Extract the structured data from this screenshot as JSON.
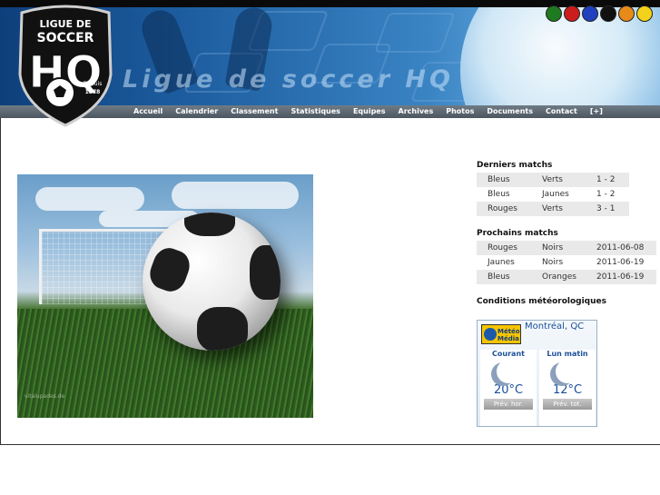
{
  "site": {
    "title": "Ligue de soccer HQ",
    "logo": {
      "line1": "LIGUE DE",
      "line2": "SOCCER",
      "initials": "HQ",
      "since": "Depuis",
      "year": "1978"
    }
  },
  "color_swatches": [
    "#1f7a1f",
    "#cc1d1d",
    "#2040c0",
    "#111111",
    "#e88a1a",
    "#f2d21a"
  ],
  "nav": [
    "Accueil",
    "Calendrier",
    "Classement",
    "Statistiques",
    "Equipes",
    "Archives",
    "Photos",
    "Documents",
    "Contact",
    "[+]"
  ],
  "hero": {
    "watermark": "vitalupades.de"
  },
  "last_matches": {
    "title": "Derniers matchs",
    "rows": [
      {
        "home": "Bleus",
        "away": "Verts",
        "score": "1 - 2"
      },
      {
        "home": "Bleus",
        "away": "Jaunes",
        "score": "1 - 2"
      },
      {
        "home": "Rouges",
        "away": "Verts",
        "score": "3 - 1"
      }
    ]
  },
  "next_matches": {
    "title": "Prochains matchs",
    "rows": [
      {
        "home": "Rouges",
        "away": "Noirs",
        "date": "2011-06-08"
      },
      {
        "home": "Jaunes",
        "away": "Noirs",
        "date": "2011-06-19"
      },
      {
        "home": "Bleus",
        "away": "Oranges",
        "date": "2011-06-19"
      }
    ]
  },
  "weather": {
    "title": "Conditions météorologiques",
    "brand_line1": "Météo",
    "brand_line2": "Média",
    "city": "Montréal, QC",
    "current": {
      "label": "Courant",
      "temp": "20°C",
      "button": "Prév. hor."
    },
    "next": {
      "label": "Lun matin",
      "temp": "12°C",
      "button": "Prév. tot."
    }
  }
}
